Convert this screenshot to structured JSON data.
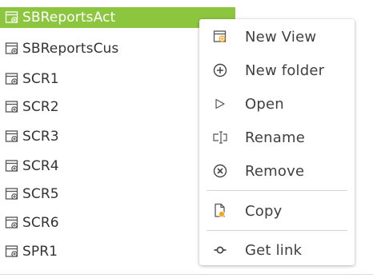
{
  "tree": {
    "items": [
      {
        "label": "SBReportsAct",
        "selected": true
      },
      {
        "label": "SBReportsCus"
      },
      {
        "label": "SCR1"
      },
      {
        "label": "SCR2"
      },
      {
        "label": "SCR3"
      },
      {
        "label": "SCR4"
      },
      {
        "label": "SCR5"
      },
      {
        "label": "SCR6"
      },
      {
        "label": "SPR1"
      }
    ],
    "item_icon": "report-icon"
  },
  "context_menu": {
    "items": [
      {
        "label": "New View",
        "icon": "new-view-icon"
      },
      {
        "label": "New folder",
        "icon": "plus-circle-icon"
      },
      {
        "label": "Open",
        "icon": "play-outline-icon"
      },
      {
        "label": "Rename",
        "icon": "rename-cursor-icon"
      },
      {
        "label": "Remove",
        "icon": "x-circle-icon"
      },
      {
        "label": "Copy",
        "icon": "copy-icon"
      },
      {
        "label": "Get link",
        "icon": "link-icon"
      }
    ]
  },
  "colors": {
    "selection": "#8cc63f",
    "accent_orange": "#f5a623",
    "text": "#333333",
    "icon": "#555555"
  }
}
